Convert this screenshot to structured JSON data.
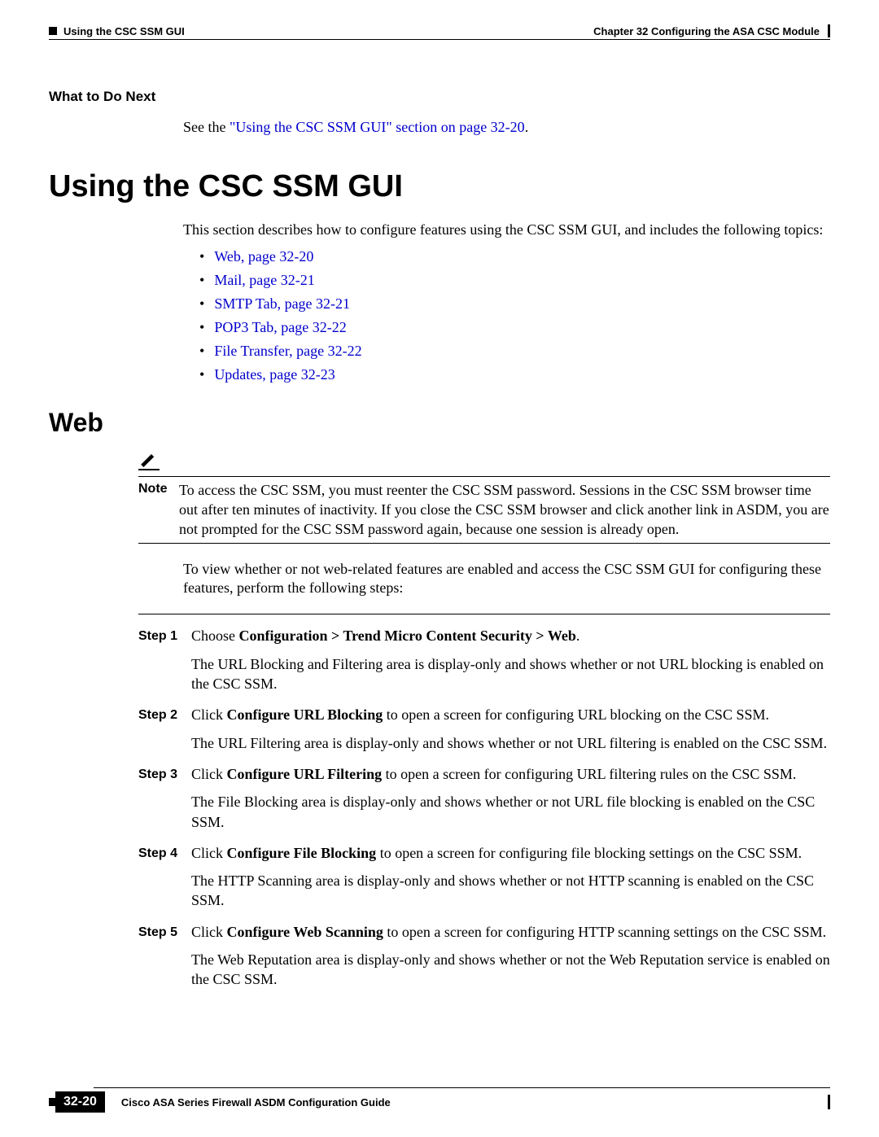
{
  "header": {
    "section": "Using the CSC SSM GUI",
    "chapter": "Chapter 32    Configuring the ASA CSC Module"
  },
  "what_next": {
    "label": "What to Do Next",
    "prefix": "See the ",
    "link": "\"Using the CSC SSM GUI\" section on page 32-20",
    "suffix": "."
  },
  "h1": "Using the CSC SSM GUI",
  "intro": "This section describes how to configure features using the CSC SSM GUI, and includes the following topics:",
  "topics": [
    "Web, page 32-20",
    "Mail, page 32-21",
    "SMTP Tab, page 32-21",
    "POP3 Tab, page 32-22",
    "File Transfer, page 32-22",
    "Updates, page 32-23"
  ],
  "h2": "Web",
  "note": {
    "label": "Note",
    "text": "To access the CSC SSM, you must reenter the CSC SSM password. Sessions in the CSC SSM browser time out after ten minutes of inactivity. If you close the CSC SSM browser and click another link in ASDM, you are not prompted for the CSC SSM password again, because one session is already open."
  },
  "para_after_note": "To view whether or not web-related features are enabled and access the CSC SSM GUI for configuring these features, perform the following steps:",
  "steps": [
    {
      "num": "Step 1",
      "t1": "Choose ",
      "b1": "Configuration > Trend Micro Content Security > Web",
      "t2": ".",
      "sub": "The URL Blocking and Filtering area is display-only and shows whether or not URL blocking is enabled on the CSC SSM."
    },
    {
      "num": "Step 2",
      "t1": "Click ",
      "b1": "Configure URL Blocking",
      "t2": " to open a screen for configuring URL blocking on the CSC SSM.",
      "sub": "The URL Filtering area is display-only and shows whether or not URL filtering is enabled on the CSC SSM."
    },
    {
      "num": "Step 3",
      "t1": "Click ",
      "b1": "Configure URL Filtering",
      "t2": " to open a screen for configuring URL filtering rules on the CSC SSM.",
      "sub": "The File Blocking area is display-only and shows whether or not URL file blocking is enabled on the CSC SSM."
    },
    {
      "num": "Step 4",
      "t1": "Click ",
      "b1": "Configure File Blocking",
      "t2": " to open a screen for configuring file blocking settings on the CSC SSM.",
      "sub": "The HTTP Scanning area is display-only and shows whether or not HTTP scanning is enabled on the CSC SSM."
    },
    {
      "num": "Step 5",
      "t1": "Click ",
      "b1": "Configure Web Scanning",
      "t2": " to open a screen for configuring HTTP scanning settings on the CSC SSM.",
      "sub": "The Web Reputation area is display-only and shows whether or not the Web Reputation service is enabled on the CSC SSM."
    }
  ],
  "footer": {
    "title": "Cisco ASA Series Firewall ASDM Configuration Guide",
    "page": "32-20"
  }
}
